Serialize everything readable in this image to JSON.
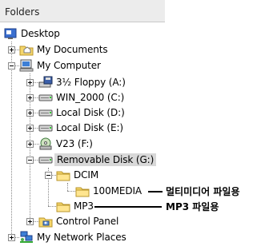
{
  "header": {
    "title": "Folders"
  },
  "tree": {
    "desktop": "Desktop",
    "my_documents": "My Documents",
    "my_computer": "My Computer",
    "floppy": "3½ Floppy (A:)",
    "win2000": "WIN_2000 (C:)",
    "local_d": "Local Disk (D:)",
    "local_e": "Local Disk (E:)",
    "v23": "V23 (F:)",
    "removable": "Removable Disk (G:)",
    "dcim": "DCIM",
    "media100": "100MEDIA",
    "mp3": "MP3",
    "control_panel": "Control Panel",
    "network": "My Network Places"
  },
  "annotations": {
    "media_note": "멀티미디어 파일용",
    "mp3_note": "MP3 파일용"
  },
  "icons": {
    "desktop": "desktop-icon",
    "folder": "folder-icon",
    "computer": "computer-icon",
    "floppy": "floppy-drive-icon",
    "hard_disk": "hard-disk-icon",
    "cd": "cd-drive-icon",
    "control_panel": "control-panel-icon",
    "network": "network-places-icon"
  }
}
